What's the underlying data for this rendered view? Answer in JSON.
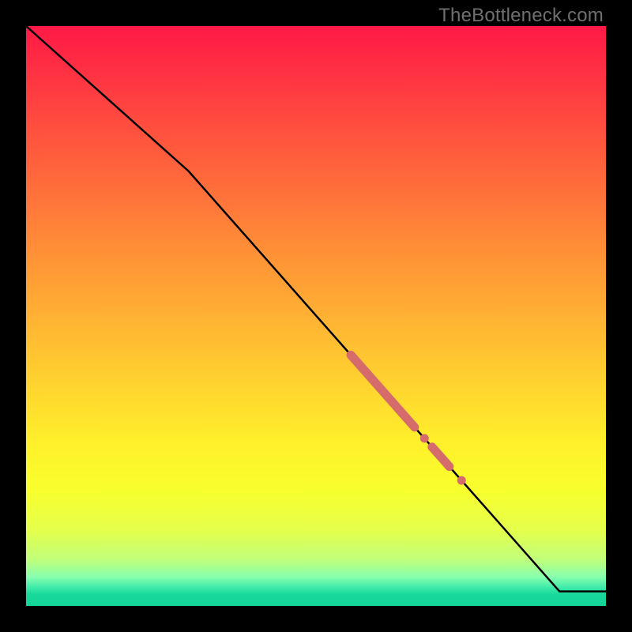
{
  "watermark": "TheBottleneck.com",
  "colors": {
    "highlight": "#d66b6b",
    "curve": "#000000"
  },
  "chart_data": {
    "type": "line",
    "title": "",
    "xlabel": "",
    "ylabel": "",
    "xlim": [
      0,
      100
    ],
    "ylim": [
      0,
      100
    ],
    "grid": false,
    "legend": false,
    "series": [
      {
        "name": "curve",
        "x": [
          0,
          28,
          92,
          100
        ],
        "y": [
          100,
          75,
          2.5,
          2.5
        ],
        "note": "piecewise: steep from (0,100) to (28,75), linear drop to (92,2.5), flat to (100,2.5)"
      }
    ],
    "highlighted_ranges": [
      {
        "x_start": 56,
        "x_end": 67,
        "note": "thick pink band on curve"
      },
      {
        "x_start": 70,
        "x_end": 73,
        "note": "short pink band"
      }
    ],
    "highlighted_points": [
      {
        "x": 68.7
      },
      {
        "x": 75.1
      }
    ],
    "background_gradient": {
      "direction": "vertical",
      "stops": [
        {
          "pos": 0.0,
          "color": "#ff1a46"
        },
        {
          "pos": 0.5,
          "color": "#ffb133"
        },
        {
          "pos": 0.8,
          "color": "#f8ff2d"
        },
        {
          "pos": 0.97,
          "color": "#38e8a8"
        },
        {
          "pos": 1.0,
          "color": "#15d497"
        }
      ]
    }
  }
}
